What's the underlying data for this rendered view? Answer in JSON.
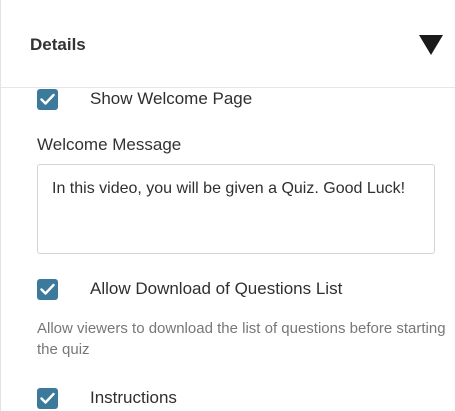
{
  "header": {
    "title": "Details",
    "toggle_icon": "caret-down-icon"
  },
  "options": {
    "show_welcome": {
      "label": "Show Welcome Page",
      "checked": true
    },
    "welcome_message": {
      "label": "Welcome Message",
      "value": "In this video, you will be given a Quiz. Good Luck!"
    },
    "allow_download": {
      "label": "Allow Download of Questions List",
      "checked": true,
      "help": "Allow viewers to download the list of questions before starting the quiz"
    },
    "instructions": {
      "label": "Instructions",
      "checked": true
    }
  },
  "colors": {
    "checkbox_fill": "#3b7a9b",
    "help_text": "#777777"
  }
}
